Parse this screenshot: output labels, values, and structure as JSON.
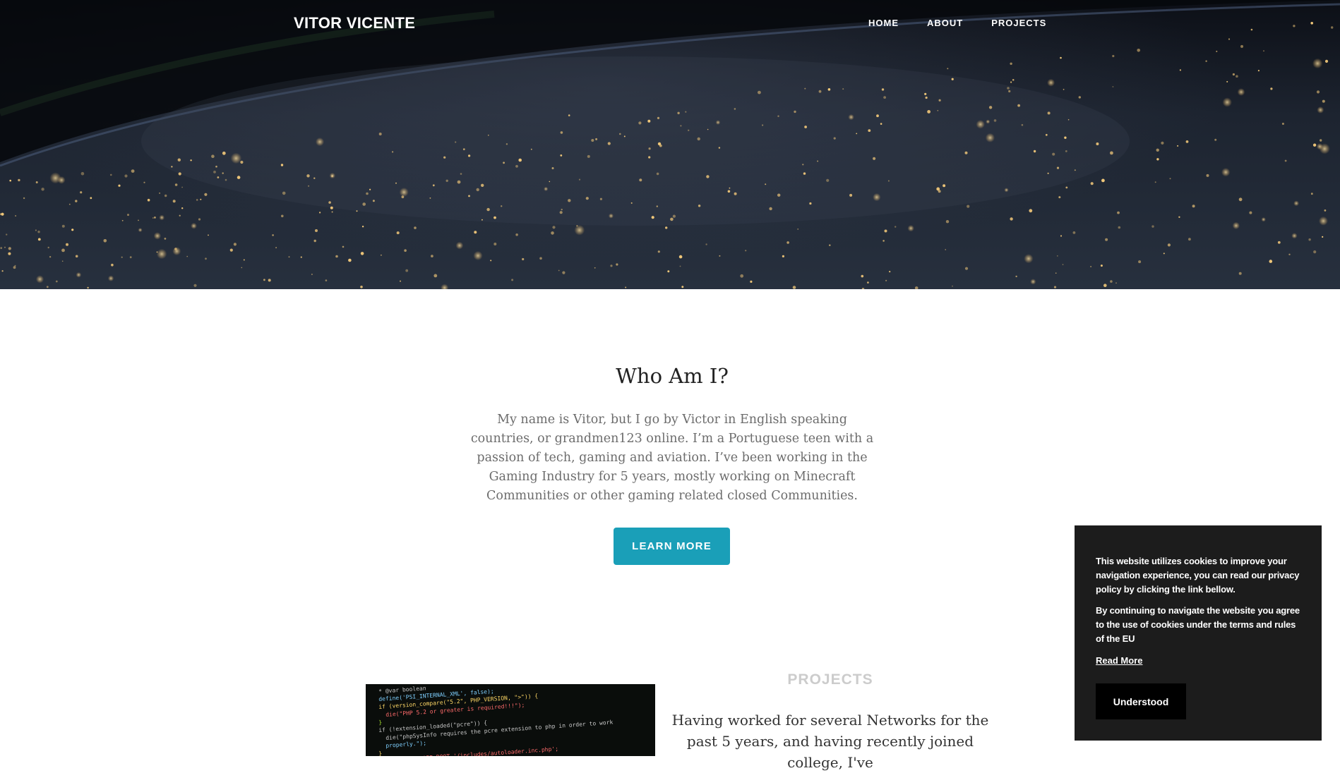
{
  "nav": {
    "brand": "VITOR VICENTE",
    "links": [
      "HOME",
      "ABOUT",
      "PROJECTS"
    ]
  },
  "about": {
    "title": "Who Am I?",
    "text": "My name is Vitor, but I go by Victor in English speaking countries, or grandmen123 online. I’m a Portuguese teen with a passion of tech, gaming and aviation. I’ve been working in the Gaming Industry for 5 years, mostly working on Minecraft Communities or other gaming related closed Communities.",
    "button": "LEARN MORE"
  },
  "projects": {
    "heading": "PROJECTS",
    "text": "Having worked for several Networks for the past 5 years, and having recently joined college, I've",
    "code_lines": [
      "* @var boolean",
      "define('PSI_INTERNAL_XML', false);",
      "if (version_compare(\"5.2\", PHP_VERSION, \">\")) {",
      "    die(\"PHP 5.2 or greater is required!!!\");",
      "}",
      "if (!extension_loaded(\"pcre\")) {",
      "    die(\"phpSysInfo requires the pcre extension to php in order to work",
      "        properly.\");",
      "}",
      "require_once APP_ROOT.'/includes/autoloader.inc.php';"
    ]
  },
  "cookie": {
    "paragraph1": "This website utilizes cookies to improve your navigation experience, you can read our privacy policy by clicking the link bellow.",
    "paragraph2": "By continuing to navigate the website you agree to the use of cookies under the terms and rules of the EU",
    "read_more": "Read More",
    "button": "Understood"
  },
  "colors": {
    "accent": "#1a9fb8",
    "cookie_bg": "#1c1c1c"
  }
}
